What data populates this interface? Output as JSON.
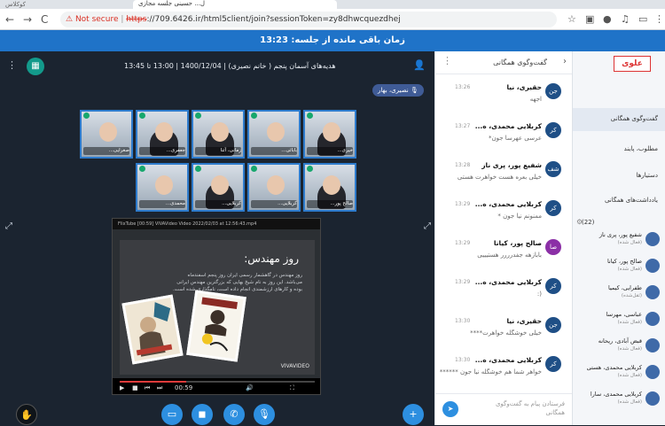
{
  "browser": {
    "tab_title": "ل... حسینی جلسه مجازی",
    "tab_ghost": "کوکلاس",
    "nav_back": "←",
    "nav_forward": "→",
    "nav_reload": "C",
    "security": "Not secure",
    "url_proto": "https",
    "url_rest": "://709.6426.ir/html5client/join?sessionToken=zy8dhwcquezdhej"
  },
  "timer": {
    "label": "زمان باقی مانده از جلسه: 13:23"
  },
  "meeting": {
    "title": "هدیه‌های آسمان پنجم ( خانم نصیری) | 1400/12/04 | 13:00 تا 13:45",
    "presenter_pill": "نصیری، بهار"
  },
  "video_tiles": [
    {
      "name": "صغرایی..."
    },
    {
      "name": "جعفری..."
    },
    {
      "name": "زمانی، آتنا"
    },
    {
      "name": "بابائی..."
    },
    {
      "name": "خیری..."
    },
    {
      "name": "محمدی..."
    },
    {
      "name": "کربلایی..."
    },
    {
      "name": "کربلایی..."
    },
    {
      "name": "صالح پور..."
    }
  ],
  "screenshare": {
    "bar_text": "FlixTube  [00:59] VIVAVideo Video 2022/02/03 at 12:56:43.mp4",
    "slide_title": "روز مهندس:",
    "slide_text": "روز مهندس در گاهشمار رسمی ایران روز پنجم اسفندماه می‌باشد. این روز به نام شیخ بهایی که بزرگترین مهندس ایرانی بوده و کارهای ارزشمندی انجام داده است، نامگذاری شده است.",
    "watermark": "VIVAVIDEO",
    "time_current": "00:59",
    "progress": 0.34
  },
  "chat": {
    "title": "گفت‌وگوی همگانی",
    "input_placeholder": "فرستادن پیام به گفت‌وگوی همگانی",
    "messages": [
      {
        "initials": "جن",
        "name": "حقیری، نیا",
        "time": "13:26",
        "text": "اجهه"
      },
      {
        "initials": "کر",
        "name": "کربلایی محمدی، ه...",
        "time": "13:27",
        "text": "عرسی عهرسا جون*"
      },
      {
        "initials": "شف",
        "name": "شفیع پور، پری ناز",
        "time": "13:28",
        "text": "خیلی بعره هست خواهرت هستی"
      },
      {
        "initials": "کر",
        "name": "کربلایی محمدی، ه...",
        "time": "13:29",
        "text": "ممنونم نیا جون *"
      },
      {
        "initials": "صا",
        "name": "صالح پور، کیانا",
        "time": "13:29",
        "text": "بابازهه جفدرررر هستیییی"
      },
      {
        "initials": "کر",
        "name": "کربلایی محمدی، ه...",
        "time": "13:29",
        "text": "(:"
      },
      {
        "initials": "جن",
        "name": "حقیری، نیا",
        "time": "13:30",
        "text": "خیلی خوشگله خواهرت****"
      },
      {
        "initials": "کر",
        "name": "کربلایی محمدی، ه...",
        "time": "13:30",
        "text": "خواهر شما هم خوشگله نیا جون ******"
      }
    ]
  },
  "sidebar": {
    "logo": "علوی",
    "menu": [
      {
        "label": "گفت‌وگوی همگانی"
      },
      {
        "label": "مطلوب، پایند"
      },
      {
        "label": "دستیارها"
      },
      {
        "label": "یادداشت‌های همگانی"
      }
    ],
    "participants_count": "(22)",
    "participants": [
      {
        "name": "شفیع پور، پری ناز",
        "role": "(فعال شده)"
      },
      {
        "name": "صالح پور، کیانا",
        "role": "(فعال شده)"
      },
      {
        "name": "طفرایی، کیمیا",
        "role": "(ثقل‌شده)"
      },
      {
        "name": "عباسی، مهرسا",
        "role": "(فعال شده)"
      },
      {
        "name": "قبض آبادی، ریحانه",
        "role": "(فعال شده)"
      },
      {
        "name": "کربلایی محمدی، هستی",
        "role": "(فعال شده)"
      },
      {
        "name": "کربلایی محمدی، سارا",
        "role": "(فعال شده)"
      }
    ]
  },
  "colors": {
    "accent": "#1f73c8",
    "video_border": "#2e7bcc",
    "teal": "#139a8b"
  }
}
